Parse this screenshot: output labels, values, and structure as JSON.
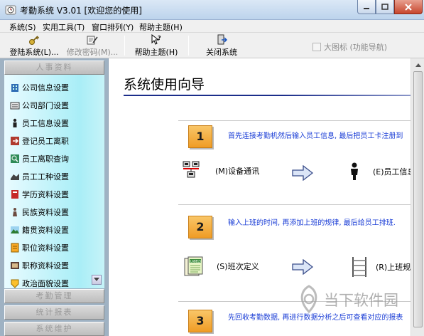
{
  "window": {
    "title": "考勤系统 V3.01 [欢迎您的使用]"
  },
  "menu": [
    "系统(S)",
    "实用工具(T)",
    "窗口排列(Y)",
    "帮助主题(H)"
  ],
  "toolbar": {
    "buttons": [
      {
        "label": "登陆系统(L)...",
        "icon": "key-icon",
        "enabled": true
      },
      {
        "label": "修改密码(M)...",
        "icon": "password-edit-icon",
        "enabled": false
      },
      {
        "label": "帮助主题(H)",
        "icon": "help-cursor-icon",
        "enabled": true
      },
      {
        "label": "关闭系统",
        "icon": "exit-door-icon",
        "enabled": true
      }
    ],
    "big_icon_checkbox": {
      "label": "大图标 (功能导航)",
      "checked": false,
      "enabled": false
    }
  },
  "nav": {
    "sections": [
      "人事资料",
      "考勤管理",
      "统计报表",
      "系统维护"
    ],
    "items": [
      {
        "label": "公司信息设置",
        "icon": "building-icon",
        "color": "#2f6db5"
      },
      {
        "label": "公司部门设置",
        "icon": "department-icon",
        "color": "#3a3a3a"
      },
      {
        "label": "员工信息设置",
        "icon": "person-icon",
        "color": "#222222"
      },
      {
        "label": "登记员工离职",
        "icon": "resign-icon",
        "color": "#b03a2e"
      },
      {
        "label": "员工离职查询",
        "icon": "query-icon",
        "color": "#2e8b57"
      },
      {
        "label": "员工工种设置",
        "icon": "job-icon",
        "color": "#444444"
      },
      {
        "label": "学历资料设置",
        "icon": "education-icon",
        "color": "#c62828"
      },
      {
        "label": "民族资料设置",
        "icon": "nation-icon",
        "color": "#6d4c41"
      },
      {
        "label": "籍贯资料设置",
        "icon": "landscape-icon",
        "color": "#2e7d32"
      },
      {
        "label": "职位资料设置",
        "icon": "position-icon",
        "color": "#f9a825"
      },
      {
        "label": "职称资料设置",
        "icon": "title-icon",
        "color": "#5d4037"
      },
      {
        "label": "政治面貌设置",
        "icon": "politics-icon",
        "color": "#fbc02d"
      }
    ]
  },
  "main": {
    "title": "系统使用向导",
    "steps": [
      {
        "number": "1",
        "text": "首先连接考勤机然后输入员工信息, 最后把员工卡注册到",
        "actions": [
          "(M)设备通讯",
          "(E)员工信息"
        ]
      },
      {
        "number": "2",
        "text": "输入上班的时间, 再添加上班的规律, 最后给员工排班.",
        "actions": [
          "(S)班次定义",
          "(R)上班规"
        ]
      },
      {
        "number": "3",
        "text": "先回收考勤数据, 再进行数据分析之后可查看对应的报表"
      }
    ]
  },
  "watermark": {
    "text": "当下软件园"
  }
}
